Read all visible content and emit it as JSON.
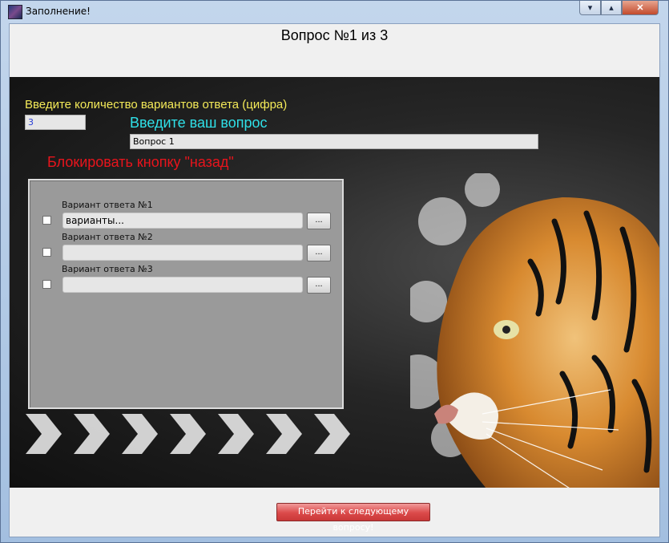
{
  "window": {
    "title": "Заполнение!",
    "controls": {
      "minimize": "▾",
      "maximize": "▴",
      "close": "✕"
    }
  },
  "header": {
    "heading": "Вопрос №1 из 3"
  },
  "form": {
    "count_label": "Введите количество вариантов ответа (цифра)",
    "count_value": "3",
    "question_label": "Введите ваш вопрос",
    "question_value": "Вопрос 1",
    "block_back_label": "Блокировать кнопку \"назад\""
  },
  "options": [
    {
      "label": "Вариант ответа №1",
      "value": "варианты...",
      "browse": "..."
    },
    {
      "label": "Вариант ответа №2",
      "value": "",
      "browse": "..."
    },
    {
      "label": "Вариант ответа №3",
      "value": "",
      "browse": "..."
    }
  ],
  "footer": {
    "next_button": "Перейти к следующему вопросу!"
  },
  "colors": {
    "count_label": "#f4ea58",
    "question_label": "#2fe0e8",
    "block_label": "#e8141c",
    "next_button": "#db4a4a"
  }
}
